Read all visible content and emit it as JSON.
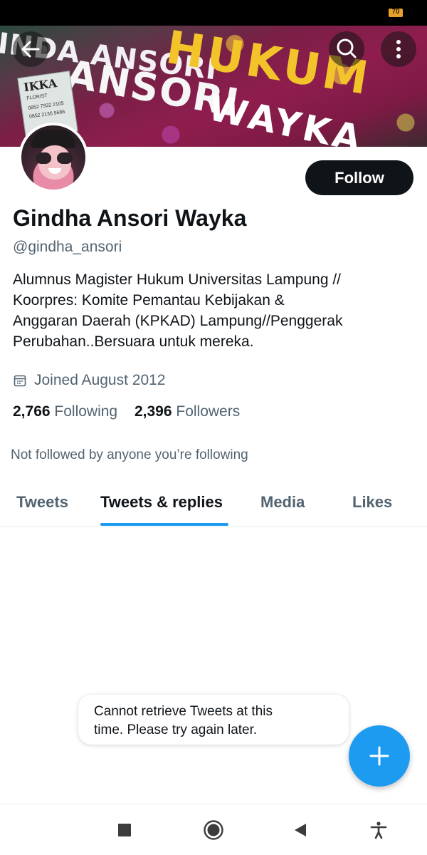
{
  "status_bar": {
    "battery_level": "70"
  },
  "banner": {
    "text_line_1": "INDA ANSORI",
    "text_line_2": "HUKUM",
    "text_line_3": "ANSORI",
    "text_line_4": "WAYKA",
    "sign_title": "IKKA",
    "sign_sub": "FLORIST",
    "sign_phone_1": "0852 7932 2105",
    "sign_phone_2": "0852 2135 9686"
  },
  "header_icons": {
    "back": "arrow-left-icon",
    "search": "search-icon",
    "more": "more-vertical-icon"
  },
  "profile": {
    "follow_label": "Follow",
    "display_name": "Gindha Ansori Wayka",
    "handle": "@gindha_ansori",
    "bio_lines": [
      "Alumnus Magister Hukum Universitas Lampung //",
      "Koorpres: Komite Pemantau Kebijakan &",
      "Anggaran Daerah (KPKAD) Lampung//Penggerak",
      "Perubahan..Bersuara untuk mereka."
    ],
    "joined": "Joined August 2012",
    "following_count": "2,766",
    "following_label": "Following",
    "followers_count": "2,396",
    "followers_label": "Followers",
    "not_followed_text": "Not followed by anyone you’re following"
  },
  "tabs": [
    {
      "label": "Tweets",
      "active": false
    },
    {
      "label": "Tweets & replies",
      "active": true
    },
    {
      "label": "Media",
      "active": false
    },
    {
      "label": "Likes",
      "active": false
    }
  ],
  "toast": {
    "line_1": "Cannot retrieve Tweets at this",
    "line_2": "time. Please try again later."
  },
  "fab": {
    "icon": "plus-icon"
  },
  "nav_bar": {
    "items": [
      "recents-square-icon",
      "home-circle-icon",
      "back-triangle-icon",
      "accessibility-icon"
    ]
  },
  "colors": {
    "accent": "#1d9bf0",
    "primary_text": "#0f1419",
    "secondary_text": "#536471",
    "follow_button_bg": "#0f1419"
  }
}
